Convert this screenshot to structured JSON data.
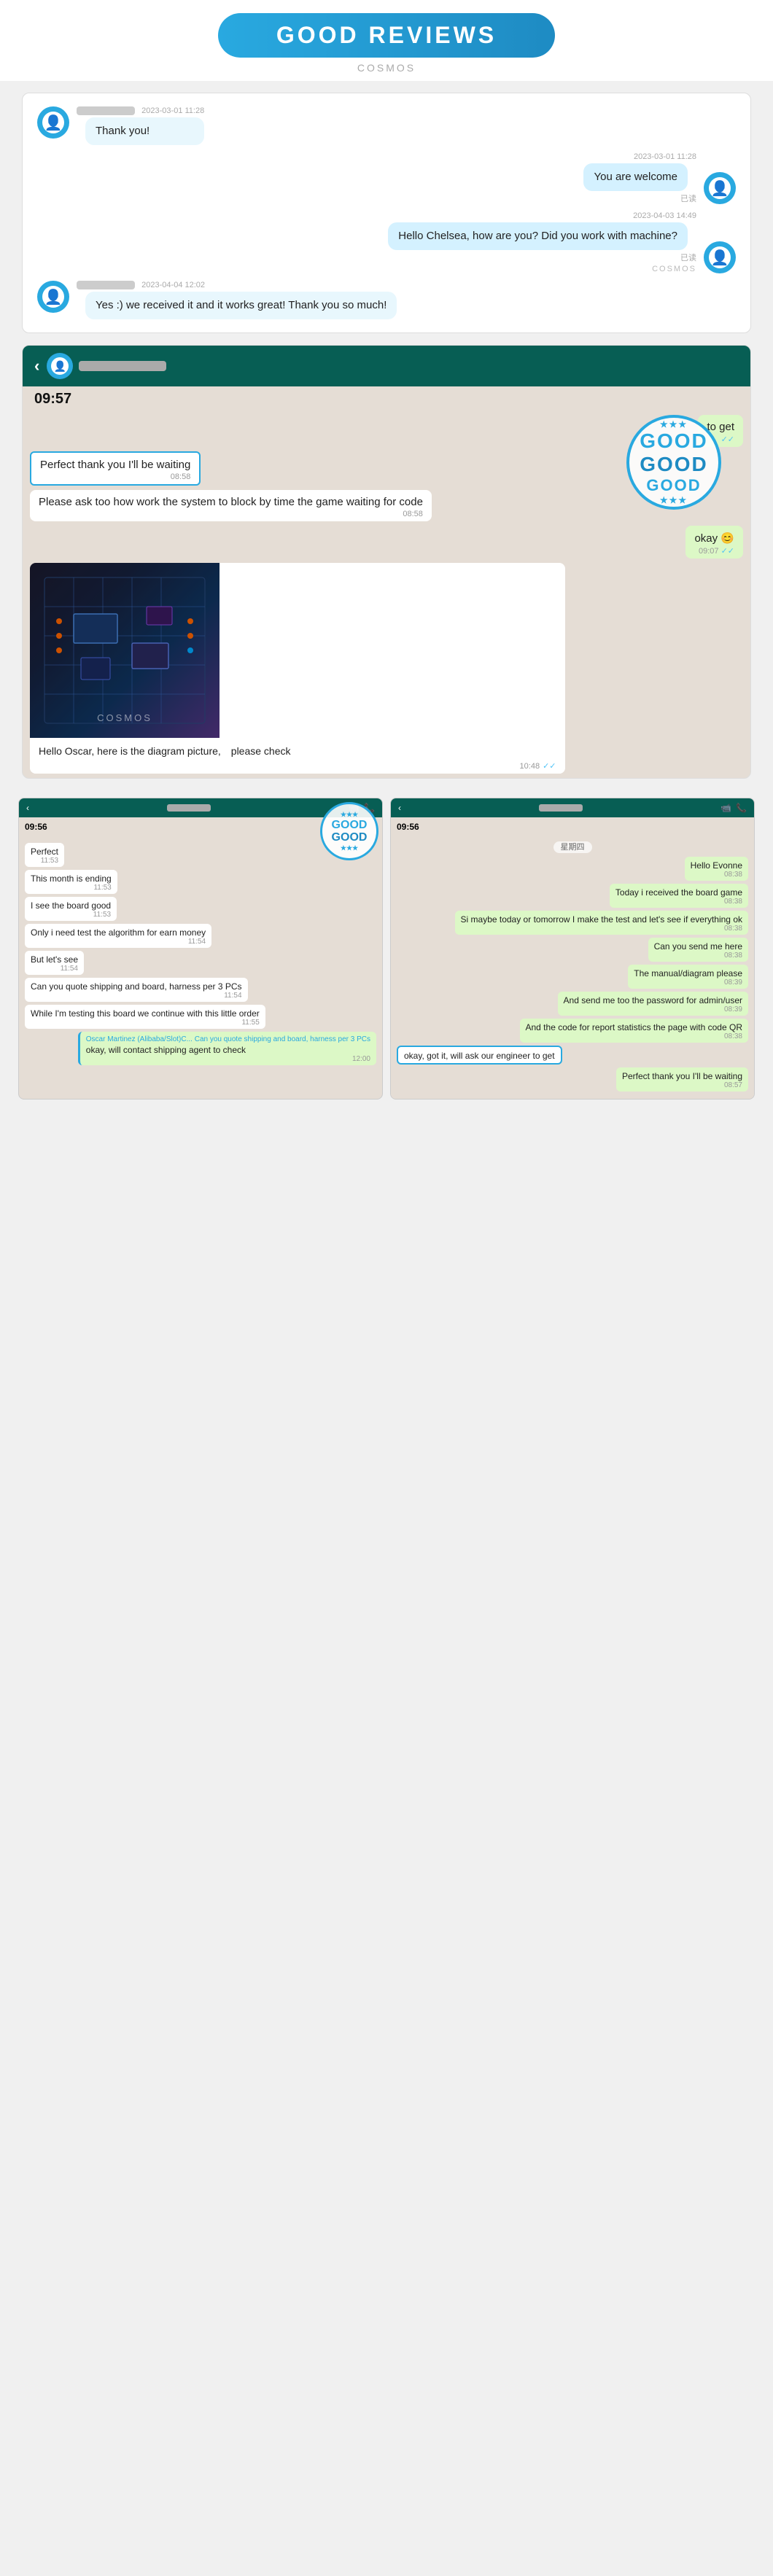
{
  "header": {
    "title": "GOOD REVIEWS",
    "watermark": "COSMOS"
  },
  "chat1": {
    "row1": {
      "name_blur": true,
      "timestamp": "2023-03-01 11:28",
      "message": "Thank you!",
      "side": "left"
    },
    "row2": {
      "timestamp": "2023-03-01 11:28",
      "message": "You are welcome",
      "side": "right",
      "read": "已读"
    },
    "row3": {
      "timestamp": "2023-04-03 14:49",
      "message": "Hello Chelsea, how are you? Did you work with machine?",
      "side": "right",
      "read": "已读"
    },
    "row4": {
      "name_blur": true,
      "timestamp": "2023-04-04 12:02",
      "message": "Yes :) we received it and it works great! Thank you so much!",
      "side": "left"
    },
    "watermark": "COSMOS"
  },
  "wa_chat": {
    "time_top": "09:57",
    "back_arrow": "‹",
    "blur_name": true,
    "messages": [
      {
        "text": "to get",
        "side": "right",
        "time": "",
        "check": "✓✓"
      },
      {
        "text": "Perfect thank you I'll be waiting",
        "side": "left",
        "time": "08:58",
        "highlight": true
      },
      {
        "text": "Please ask too how work the system to block by time the game waiting for code",
        "side": "left",
        "time": "08:58"
      },
      {
        "text": "okay 😊",
        "side": "right",
        "time": "09:07",
        "check": "✓✓"
      }
    ],
    "image_caption": "Hello Oscar, here is the diagram picture,　please check",
    "image_time": "10:48",
    "image_check": "✓✓",
    "good_stamp": {
      "top": "GOOD",
      "middle": "GOOD",
      "bottom": "GOOD",
      "stars_top": "★ ★ ★",
      "stars_bottom": "★ ★ ★"
    },
    "cosmos_watermark": "COSMOS"
  },
  "dual_left": {
    "time": "09:56",
    "signals": "▲▲ ✦ ●",
    "back": "‹",
    "messages": [
      {
        "text": "Perfect",
        "side": "left",
        "time": "11:53"
      },
      {
        "text": "This month is ending",
        "side": "left",
        "time": "11:53"
      },
      {
        "text": "I see the board good",
        "side": "left",
        "time": "11:53"
      },
      {
        "text": "Only i need test the algorithm for earn money",
        "side": "left",
        "time": "11:54"
      },
      {
        "text": "But let's see",
        "side": "left",
        "time": "11:54"
      },
      {
        "text": "Can you quote shipping and board, harness per 3 PCs",
        "side": "left",
        "time": "11:54"
      },
      {
        "text": "While I'm testing this board we continue with this little order",
        "side": "left",
        "time": "11:55"
      },
      {
        "text": "okay, will contact shipping agent to check",
        "side": "right",
        "time": "12:00"
      }
    ],
    "quoted_text": "Oscar Martinez (Alibaba/Slot)C...\nCan you quote shipping and board, harness per 3 PCs",
    "good_stamp": {
      "text": "GOOD"
    }
  },
  "dual_right": {
    "time": "09:56",
    "signals": "▲▲ ✦ ●",
    "back": "‹",
    "day_label": "星期四",
    "messages": [
      {
        "text": "Hello Evonne",
        "side": "right",
        "time": "08:38"
      },
      {
        "text": "Today i received the board game",
        "side": "right",
        "time": "08:38"
      },
      {
        "text": "Si maybe today or tomorrow I make the test and let's see if everything ok",
        "side": "right",
        "time": "08:38"
      },
      {
        "text": "Can you send me here",
        "side": "right",
        "time": "08:38"
      },
      {
        "text": "The manual/diagram please",
        "side": "right",
        "time": "08:39"
      },
      {
        "text": "And send me too the password for admin/user",
        "side": "right",
        "time": "08:39"
      },
      {
        "text": "And the code for report statistics the page with code QR",
        "side": "right",
        "time": "08:38"
      },
      {
        "text": "okay, got it, will ask our engineer to get",
        "side": "left",
        "time": "",
        "highlight": true
      },
      {
        "text": "Perfect thank you I'll be waiting",
        "side": "right",
        "time": "08:57"
      }
    ]
  }
}
